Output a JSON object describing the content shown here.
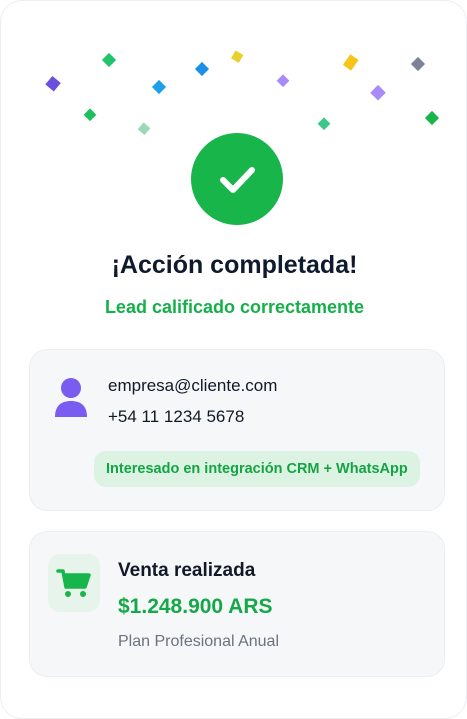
{
  "success": {
    "title": "¡Acción completada!",
    "subtitle": "Lead calificado correctamente"
  },
  "lead": {
    "email": "empresa@cliente.com",
    "phone": "+54 11 1234 5678",
    "tag": "Interesado en integración CRM + WhatsApp"
  },
  "sale": {
    "title": "Venta realizada",
    "amount": "$1.248.900 ARS",
    "plan": "Plan Profesional Anual"
  },
  "colors": {
    "success_green": "#17b54a",
    "accent_purple": "#7b5cf0",
    "tag_bg": "#dcf3e3",
    "panel_bg": "#f6f7f9"
  },
  "icons": {
    "success": "check-icon",
    "lead": "user-icon",
    "sale": "shopping-cart-icon"
  }
}
